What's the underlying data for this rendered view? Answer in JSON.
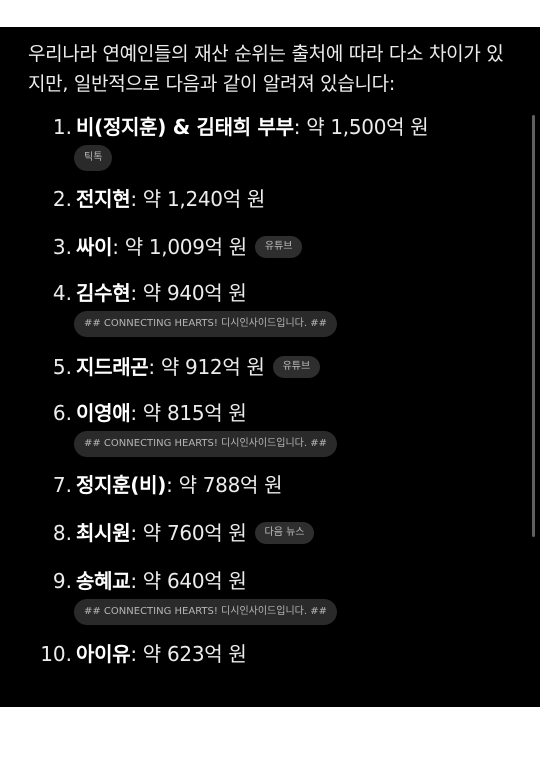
{
  "intro": "우리나라 연예인들의 재산 순위는 출처에 따라 다소 차이가 있지만, 일반적으로 다음과 같이 알려져 있습니다:",
  "items": [
    {
      "num": "1.",
      "name": "비(정지훈) & 김태희 부부",
      "value": ": 약 1,500억 원",
      "badge_under": "틱톡"
    },
    {
      "num": "2.",
      "name": "전지현",
      "value": ": 약 1,240억 원"
    },
    {
      "num": "3.",
      "name": "싸이",
      "value": ": 약 1,009억 원",
      "badge_inline": "유튜브"
    },
    {
      "num": "4.",
      "name": "김수현",
      "value": ": 약 940억 원",
      "badge_under": "## CONNECTING HEARTS! 디시인사이드입니다. ##"
    },
    {
      "num": "5.",
      "name": "지드래곤",
      "value": ": 약 912억 원",
      "badge_inline": "유튜브"
    },
    {
      "num": "6.",
      "name": "이영애",
      "value": ": 약 815억 원",
      "badge_under": "## CONNECTING HEARTS! 디시인사이드입니다. ##"
    },
    {
      "num": "7.",
      "name": "정지훈(비)",
      "value": ": 약 788억 원"
    },
    {
      "num": "8.",
      "name": "최시원",
      "value": ": 약 760억 원",
      "badge_inline": "다음 뉴스"
    },
    {
      "num": "9.",
      "name": "송혜교",
      "value": ": 약 640억 원",
      "badge_under": "## CONNECTING HEARTS! 디시인사이드입니다. ##"
    },
    {
      "num": "10.",
      "name": "아이유",
      "value": ": 약 623억 원"
    }
  ]
}
